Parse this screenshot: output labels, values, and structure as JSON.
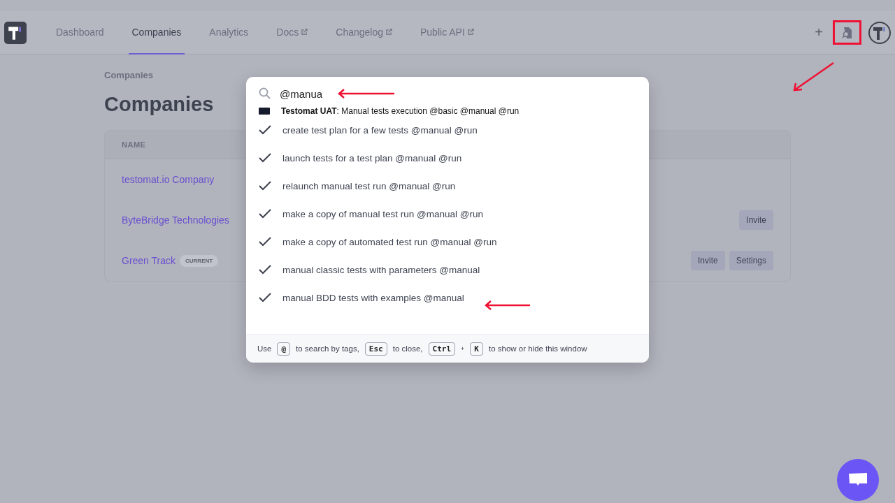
{
  "nav": {
    "tabs": [
      {
        "label": "Dashboard",
        "selected": false,
        "external": false
      },
      {
        "label": "Companies",
        "selected": true,
        "external": false
      },
      {
        "label": "Analytics",
        "selected": false,
        "external": false
      },
      {
        "label": "Docs",
        "selected": false,
        "external": true
      },
      {
        "label": "Changelog",
        "selected": false,
        "external": true
      },
      {
        "label": "Public API",
        "selected": false,
        "external": true
      }
    ],
    "add_label": "+"
  },
  "breadcrumb": "Companies",
  "heading": "Companies",
  "table": {
    "columns": [
      "NAME"
    ],
    "rows": [
      {
        "name": "testomat.io Company",
        "badge": null,
        "actions": []
      },
      {
        "name": "ByteBridge Technologies",
        "badge": null,
        "actions": [
          "Invite"
        ]
      },
      {
        "name": "Green Track",
        "badge": "CURRENT",
        "actions": [
          "Invite",
          "Settings"
        ]
      }
    ]
  },
  "search": {
    "value": "@manua",
    "results": [
      {
        "kind": "project",
        "text": "**Testomat UAT**: Manual tests execution @basic @manual @run"
      },
      {
        "kind": "test",
        "text": "create test plan for a few tests @manual @run"
      },
      {
        "kind": "test",
        "text": "launch tests for a test plan @manual @run"
      },
      {
        "kind": "test",
        "text": "relaunch manual test run @manual @run"
      },
      {
        "kind": "test",
        "text": "make a copy of manual test run @manual @run"
      },
      {
        "kind": "test",
        "text": "make a copy of automated test run @manual @run"
      },
      {
        "kind": "test",
        "text": "manual classic tests with parameters @manual"
      },
      {
        "kind": "test",
        "text": "manual BDD tests with examples @manual"
      }
    ],
    "hint": [
      {
        "kind": "text",
        "text": "Use"
      },
      {
        "kind": "key",
        "text": "@"
      },
      {
        "kind": "text",
        "text": "to search by tags,"
      },
      {
        "kind": "key",
        "text": "Esc"
      },
      {
        "kind": "text",
        "text": "to close,"
      },
      {
        "kind": "key",
        "text": "Ctrl"
      },
      {
        "kind": "plus",
        "text": "+"
      },
      {
        "kind": "key",
        "text": "K"
      },
      {
        "kind": "text",
        "text": "to show or hide this window"
      }
    ]
  }
}
